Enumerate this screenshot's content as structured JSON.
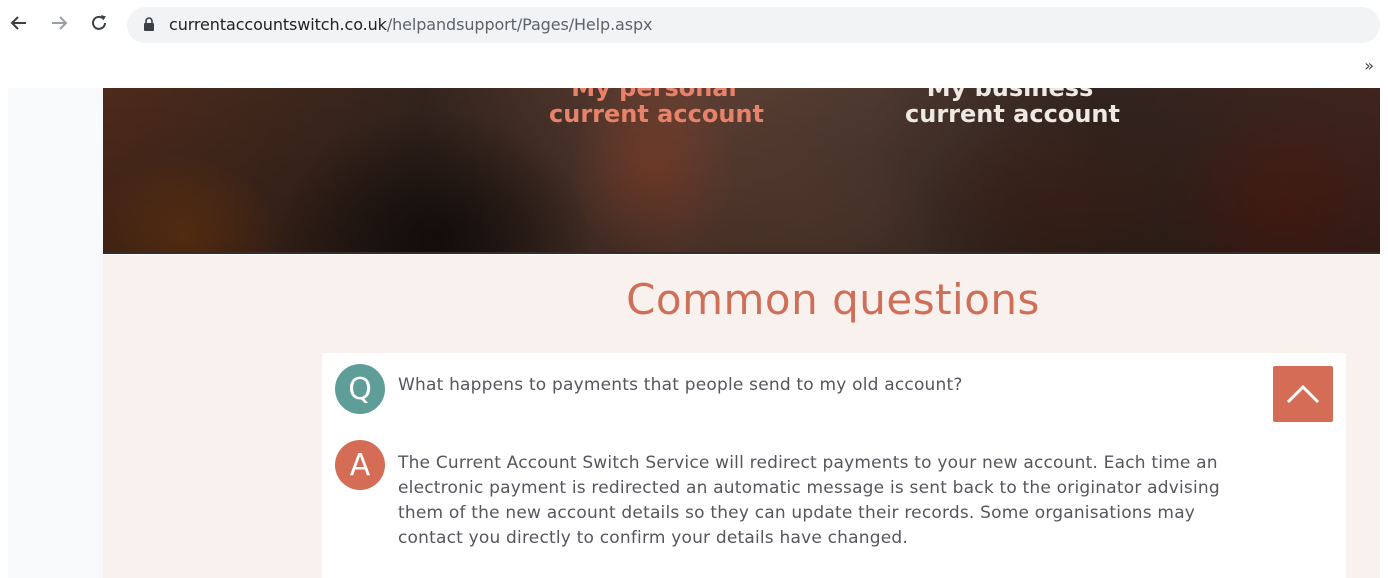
{
  "browser": {
    "url_host": "currentaccountswitch.co.uk",
    "url_path": "/helpandsupport/Pages/Help.aspx",
    "overflow_label": "»"
  },
  "hero": {
    "personal_link": {
      "line1": "My personal",
      "line2": "current account"
    },
    "business_link": {
      "line1": "My business",
      "line2": "current account"
    }
  },
  "faq": {
    "heading": "Common questions",
    "question_badge": "Q",
    "answer_badge": "A",
    "question": "What happens to payments that people send to my old account?",
    "answer": "The Current Account Switch Service will redirect payments to your new account. Each time an electronic payment is redirected an automatic message is sent back to the originator advising them of the new account details so they can update their records. Some organisations may contact you directly to confirm your details have changed.",
    "collapse_icon": "chevron-up-icon"
  },
  "colors": {
    "accent": "#d56d56",
    "question_badge": "#5e9d98",
    "heading": "#cf6f58",
    "section_bg": "#f8f1ee"
  }
}
